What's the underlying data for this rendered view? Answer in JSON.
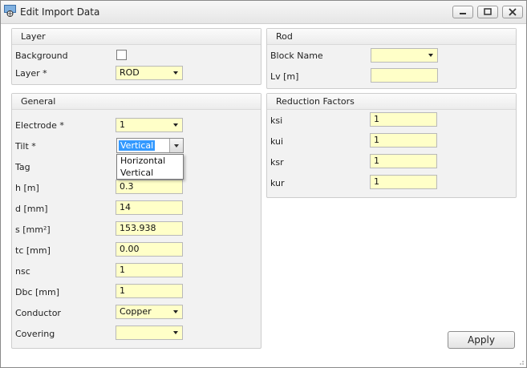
{
  "window": {
    "title": "Edit Import Data"
  },
  "layer": {
    "header": "Layer",
    "background_label": "Background",
    "background_checked": false,
    "layer_label": "Layer *",
    "layer_value": "ROD"
  },
  "general": {
    "header": "General",
    "electrode_label": "Electrode *",
    "electrode_value": "1",
    "tilt_label": "Tilt *",
    "tilt_value": "Vertical",
    "tilt_options": [
      "Horizontal",
      "Vertical"
    ],
    "tag_label": "Tag",
    "h_label": "h [m]",
    "h_value": "0.3",
    "d_label": "d [mm]",
    "d_value": "14",
    "s_label": "s [mm²]",
    "s_value": "153.938",
    "tc_label": "tc [mm]",
    "tc_value": "0.00",
    "nsc_label": "nsc",
    "nsc_value": "1",
    "dbc_label": "Dbc [mm]",
    "dbc_value": "1",
    "conductor_label": "Conductor",
    "conductor_value": "Copper",
    "covering_label": "Covering",
    "covering_value": ""
  },
  "rod": {
    "header": "Rod",
    "block_name_label": "Block Name",
    "block_name_value": "",
    "lv_label": "Lv [m]",
    "lv_value": ""
  },
  "reduction": {
    "header": "Reduction Factors",
    "ksi_label": "ksi",
    "ksi_value": "1",
    "kui_label": "kui",
    "kui_value": "1",
    "ksr_label": "ksr",
    "ksr_value": "1",
    "kur_label": "kur",
    "kur_value": "1"
  },
  "actions": {
    "apply_label": "Apply"
  }
}
